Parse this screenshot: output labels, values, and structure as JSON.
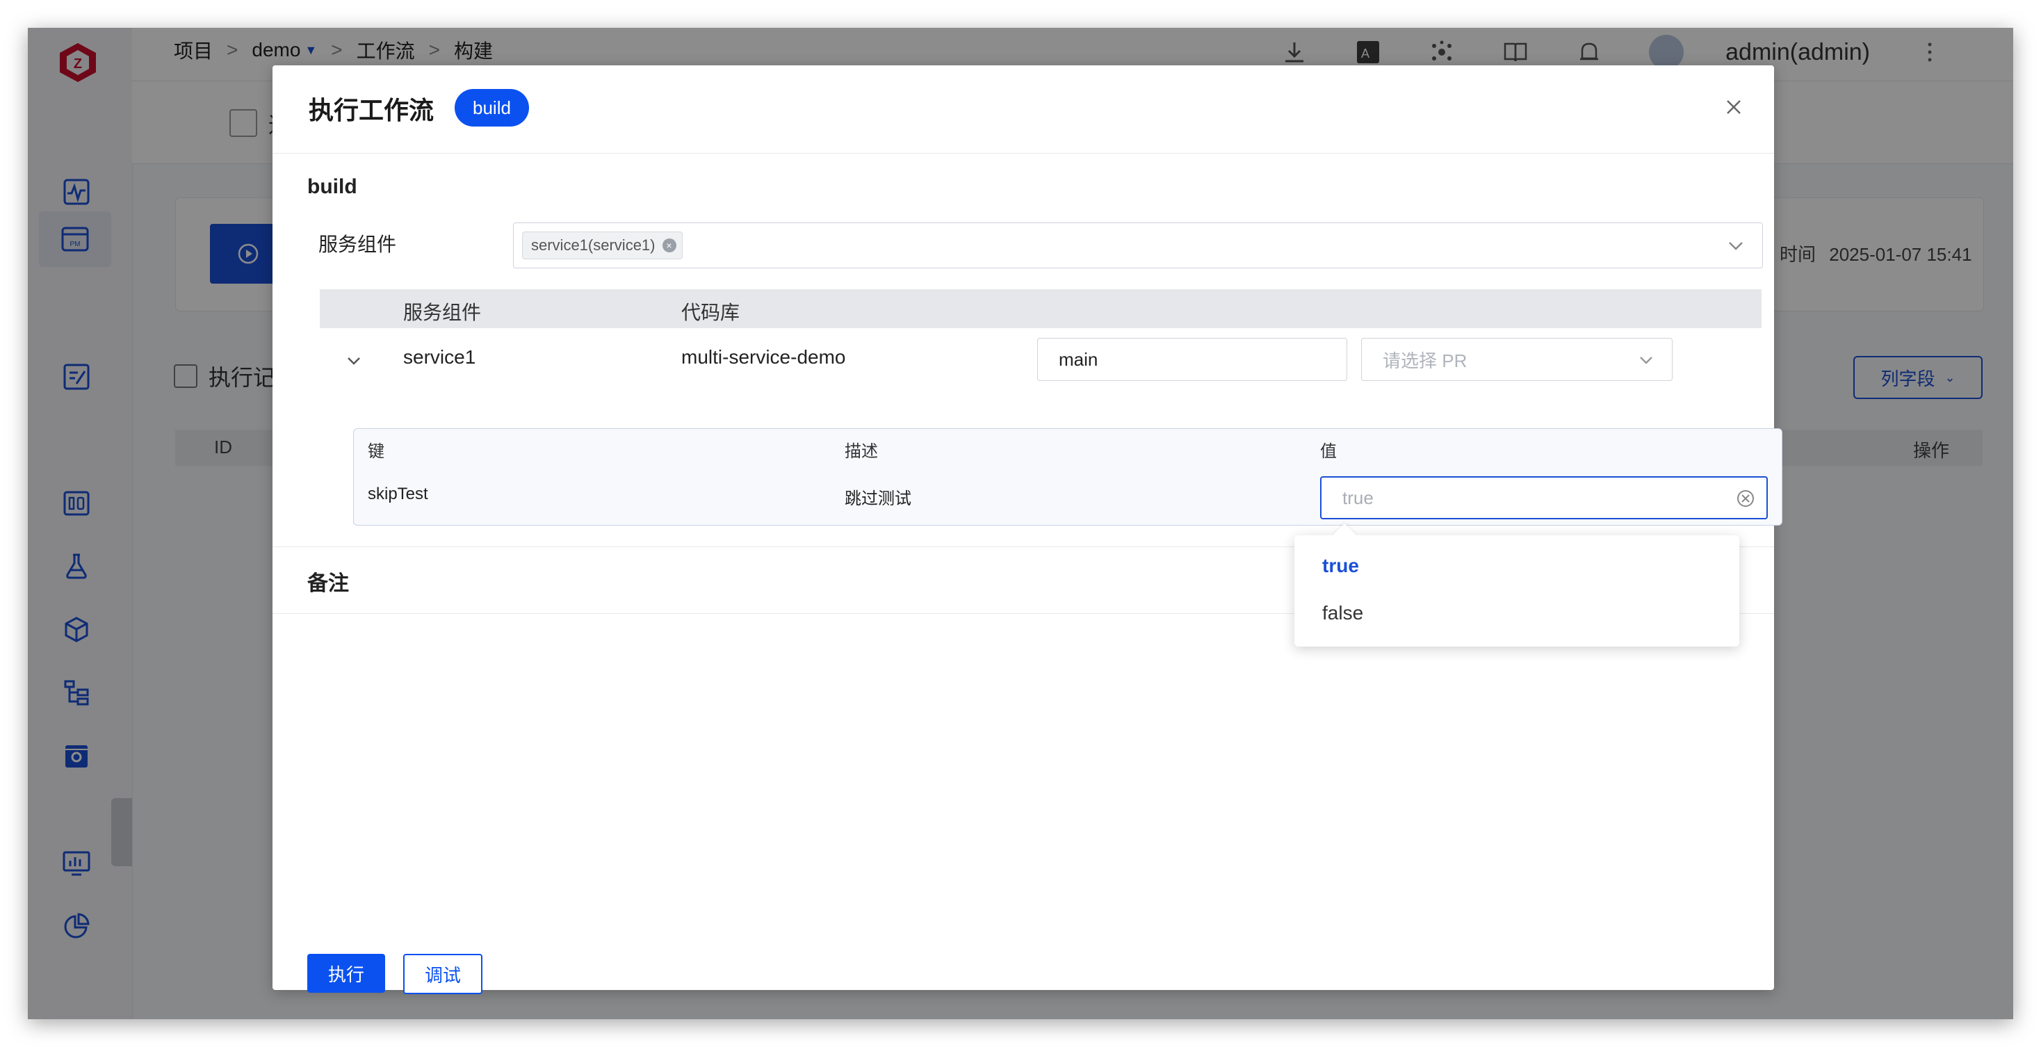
{
  "breadcrumb": {
    "items": [
      "项目",
      "demo",
      "工作流",
      "构建"
    ],
    "sep": ">"
  },
  "topbar": {
    "user": "admin(admin)"
  },
  "background": {
    "section_char": "迭代",
    "history_title": "执行记录",
    "col_id": "ID",
    "col_ops": "操作",
    "time_label": "时间",
    "time_value": "2025-01-07 15:41",
    "column_fields_button": "列字段"
  },
  "modal": {
    "title": "执行工作流",
    "workflow_tag": "build",
    "section_build": "build",
    "service_label": "服务组件",
    "service_chip": "service1(service1)",
    "table": {
      "headers": [
        "服务组件",
        "代码库"
      ],
      "row": {
        "service": "service1",
        "repo": "multi-service-demo",
        "branch": "main",
        "pr_placeholder": "请选择 PR"
      }
    },
    "params": {
      "headers": {
        "key": "键",
        "desc": "描述",
        "value": "值"
      },
      "row": {
        "key": "skipTest",
        "desc": "跳过测试",
        "value_placeholder": "true"
      }
    },
    "dropdown_options": [
      "true",
      "false"
    ],
    "notes_label": "备注",
    "execute_button": "执行",
    "debug_button": "调试"
  },
  "colors": {
    "accent": "#0a51f0",
    "annotation_arrow": "#d0021b"
  }
}
